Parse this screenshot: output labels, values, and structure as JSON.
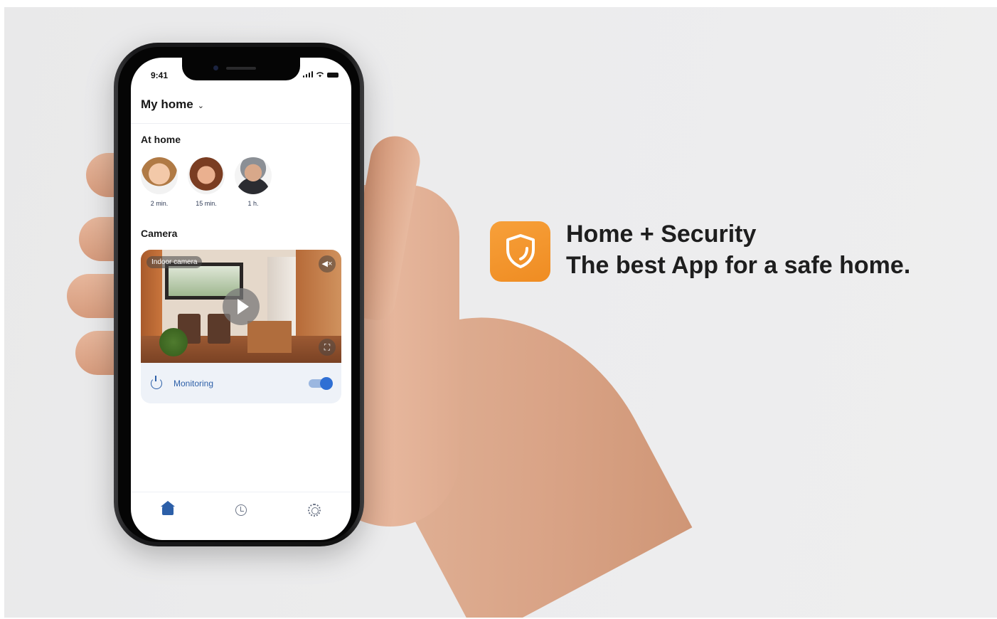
{
  "phone": {
    "status_time": "9:41",
    "header": {
      "title": "My home",
      "dropdown_icon": "chevron-down-icon"
    },
    "at_home": {
      "heading": "At home",
      "people": [
        {
          "time": "2 min."
        },
        {
          "time": "15 min."
        },
        {
          "time": "1 h."
        }
      ]
    },
    "camera": {
      "heading": "Camera",
      "label": "Indoor camera",
      "mute_icon": "mute-icon",
      "monitoring_label": "Monitoring",
      "monitoring_on": true
    },
    "tabs": [
      "home-icon",
      "history-icon",
      "gear-icon"
    ]
  },
  "promo": {
    "line1": "Home + Security",
    "line2": "The best App for a safe home.",
    "accent": "#F39A2E"
  }
}
